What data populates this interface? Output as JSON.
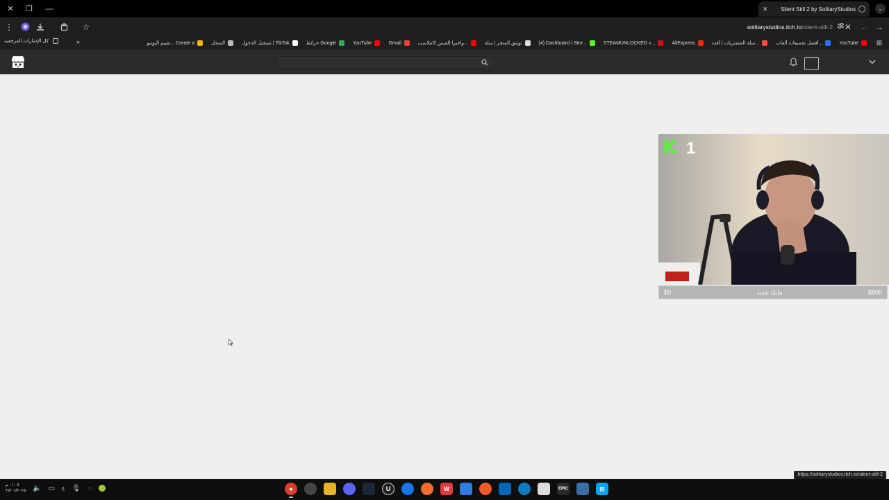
{
  "tab": {
    "title": "Silent Still 2 by SolitaryStudios"
  },
  "address": {
    "host": "solitarystudios.itch.io",
    "path": "/silent-still-2"
  },
  "bookmarks": {
    "items": [
      {
        "label": "YouTube",
        "color": "#ff0000"
      },
      {
        "label": "أفضل تجميعات ألعاب...",
        "color": "#2f6df6"
      },
      {
        "label": "سلة المشتريات | أفت...",
        "color": "#ff4d3d"
      },
      {
        "label": "AliExpress",
        "color": "#e62e04"
      },
      {
        "label": "STEAMUNLOCKED »...",
        "color": "#cc1111"
      },
      {
        "label": "(4) Dashboard / Stre...",
        "color": "#53fc18"
      },
      {
        "label": "توثيق المتجر | سلة",
        "color": "#dddddd"
      },
      {
        "label": "واخيرا القيس كاملاسب...",
        "color": "#ff0000"
      },
      {
        "label": "Gmail",
        "color": "#ea4335"
      },
      {
        "label": "YouTube",
        "color": "#ff0000"
      },
      {
        "label": "خرائط Google",
        "color": "#34a853"
      },
      {
        "label": "تسجيل الدخول | TikTok",
        "color": "#ffffff"
      },
      {
        "label": "السجل",
        "color": "#bbbbbb"
      },
      {
        "label": "تقييم اليوتيو... Create a",
        "color": "#f4b400"
      }
    ],
    "all_bookmarks": "كل الإشارات المرجعية"
  },
  "search": {
    "placeholder": ""
  },
  "webcam": {
    "badge_count": "1",
    "goal": {
      "start": "$0",
      "label": "مايك جديد",
      "end": "$800"
    }
  },
  "status_url": "https://solitarystudios.itch.io/silent-still-2",
  "taskbar": {
    "time": "٠١:٠٤ م",
    "date": "٢٧/٠٦/٢٠٢٥",
    "lang": "ع",
    "apps": [
      {
        "name": "chrome",
        "color": "#d9402b",
        "active": true
      },
      {
        "name": "obs",
        "color": "#444444"
      },
      {
        "name": "files",
        "color": "#e6b422"
      },
      {
        "name": "discord",
        "color": "#5865f2"
      },
      {
        "name": "steam",
        "color": "#1b2838"
      },
      {
        "name": "unreal",
        "color": "#222222"
      },
      {
        "name": "chrome-alt",
        "color": "#1a73e8"
      },
      {
        "name": "origin",
        "color": "#f56c2d"
      },
      {
        "name": "wps",
        "color": "#e03a3e"
      },
      {
        "name": "shield",
        "color": "#2f7de1"
      },
      {
        "name": "nodes",
        "color": "#f05a28"
      },
      {
        "name": "store",
        "color": "#0067b8"
      },
      {
        "name": "edge",
        "color": "#0f7bc4"
      },
      {
        "name": "calendar",
        "color": "#dddddd"
      },
      {
        "name": "epic",
        "color": "#2a2a2a"
      },
      {
        "name": "installer",
        "color": "#3a6ea5"
      },
      {
        "name": "windows",
        "color": "#00a4ef"
      }
    ]
  }
}
